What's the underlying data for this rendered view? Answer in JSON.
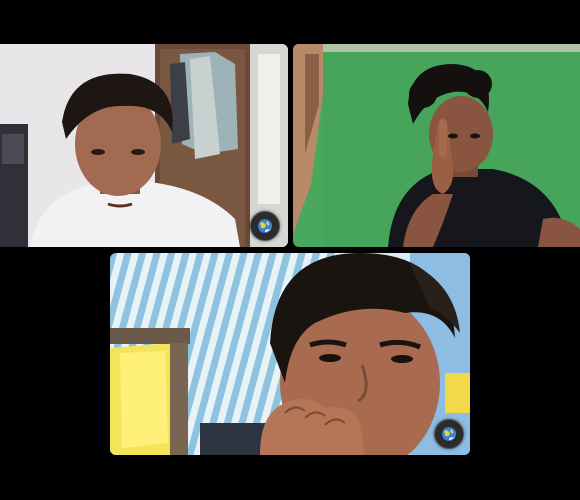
{
  "call": {
    "participants": [
      {
        "id": "p1",
        "avatar_icon": "globe-avatar-icon"
      },
      {
        "id": "p2"
      },
      {
        "id": "p3",
        "avatar_icon": "globe-avatar-icon"
      }
    ]
  },
  "colors": {
    "background": "#000000",
    "green_wall": "#4aa85e",
    "avatar_badge": "#2b2b2b"
  }
}
